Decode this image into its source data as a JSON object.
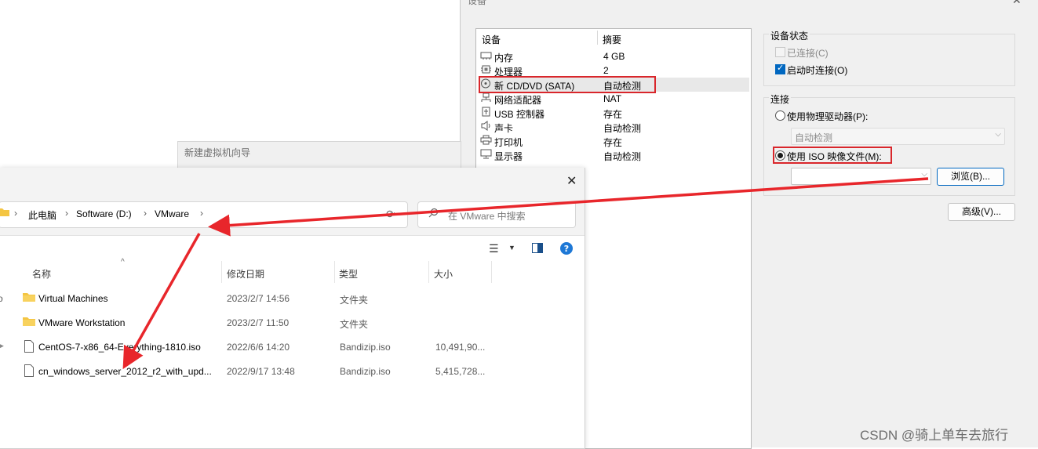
{
  "vm_settings": {
    "title": "设备",
    "columns": {
      "device": "设备",
      "summary": "摘要"
    },
    "devices": [
      {
        "name": "内存",
        "summary": "4 GB",
        "icon": "memory-icon"
      },
      {
        "name": "处理器",
        "summary": "2",
        "icon": "cpu-icon"
      },
      {
        "name": "新 CD/DVD (SATA)",
        "summary": "自动检测",
        "icon": "cd-dvd-icon",
        "selected": true
      },
      {
        "name": "网络适配器",
        "summary": "NAT",
        "icon": "network-adapter-icon"
      },
      {
        "name": "USB 控制器",
        "summary": "存在",
        "icon": "usb-icon"
      },
      {
        "name": "声卡",
        "summary": "自动检测",
        "icon": "sound-card-icon"
      },
      {
        "name": "打印机",
        "summary": "存在",
        "icon": "printer-icon"
      },
      {
        "name": "显示器",
        "summary": "自动检测",
        "icon": "display-icon"
      }
    ],
    "device_status": {
      "label": "设备状态",
      "connected": {
        "label": "已连接(C)",
        "checked": false,
        "disabled": true
      },
      "connect_at_power_on": {
        "label": "启动时连接(O)",
        "checked": true
      }
    },
    "connection": {
      "label": "连接",
      "physical_drive": {
        "label": "使用物理驱动器(P):",
        "selected": false
      },
      "physical_drive_value": "自动检测",
      "iso_image": {
        "label": "使用 ISO 映像文件(M):",
        "selected": true
      },
      "iso_path": "",
      "browse_label": "浏览(B)..."
    },
    "advanced_label": "高级(V)..."
  },
  "wizard": {
    "title": "新建虚拟机向导"
  },
  "file_dialog": {
    "breadcrumbs": [
      "此电脑",
      "Software (D:)",
      "VMware"
    ],
    "search_placeholder": "在 VMware 中搜索",
    "columns": {
      "name": "名称",
      "date": "修改日期",
      "type": "类型",
      "size": "大小"
    },
    "files": [
      {
        "name": "Virtual Machines",
        "date": "2023/2/7 14:56",
        "type": "文件夹",
        "size": "",
        "kind": "folder"
      },
      {
        "name": "VMware Workstation",
        "date": "2023/2/7 11:50",
        "type": "文件夹",
        "size": "",
        "kind": "folder"
      },
      {
        "name": "CentOS-7-x86_64-Everything-1810.iso",
        "date": "2022/6/6 14:20",
        "type": "Bandizip.iso",
        "size": "10,491,90...",
        "kind": "file"
      },
      {
        "name": "cn_windows_server_2012_r2_with_upd...",
        "date": "2022/9/17 13:48",
        "type": "Bandizip.iso",
        "size": "5,415,728...",
        "kind": "file"
      }
    ]
  },
  "watermark": "CSDN @骑上单车去旅行",
  "colors": {
    "highlight": "#d9262b",
    "accent": "#0067c0"
  }
}
